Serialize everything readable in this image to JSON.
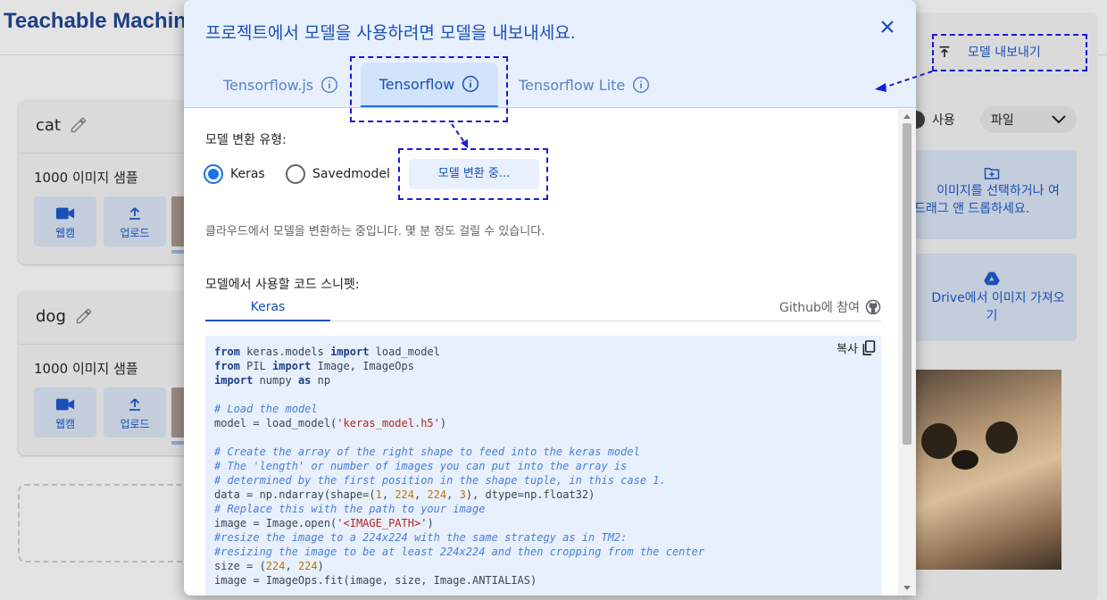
{
  "app": {
    "title": "Teachable Machine"
  },
  "classes": [
    {
      "name": "cat",
      "count": "1000 이미지 샘플",
      "webcam_label": "웹캠",
      "upload_label": "업로드"
    },
    {
      "name": "dog",
      "count": "1000 이미지 샘플",
      "webcam_label": "웹캠",
      "upload_label": "업로드"
    }
  ],
  "right_panel": {
    "export_label": "모델 내보내기",
    "use_label": "사용",
    "source_select": "파일",
    "upload_text_1": "이미지를 선택하거나 여",
    "upload_text_2": "드래그 앤 드롭하세요.",
    "drive_text_1": "Drive에서 이미지 가져오",
    "drive_text_2": "기"
  },
  "dialog": {
    "title": "프로젝트에서 모델을 사용하려면 모델을 내보내세요.",
    "tabs": [
      {
        "label": "Tensorflow.js",
        "active": false
      },
      {
        "label": "Tensorflow",
        "active": true
      },
      {
        "label": "Tensorflow Lite",
        "active": false
      }
    ],
    "conversion_label": "모델 변환 유형:",
    "options": [
      {
        "label": "Keras",
        "selected": true
      },
      {
        "label": "Savedmodel",
        "selected": false
      }
    ],
    "convert_button": "모델 변환 중...",
    "note": "클라우드에서 모델을 변환하는 중입니다. 몇 분 정도 걸릴 수 있습니다.",
    "snippet_label": "모델에서 사용할 코드 스니펫:",
    "snippet_tab": "Keras",
    "github_link": "Github에 참여",
    "copy_label": "복사"
  },
  "colors": {
    "accent": "#1a73e8",
    "brand": "#1d3f86",
    "header_bg": "#e8f0fe"
  }
}
